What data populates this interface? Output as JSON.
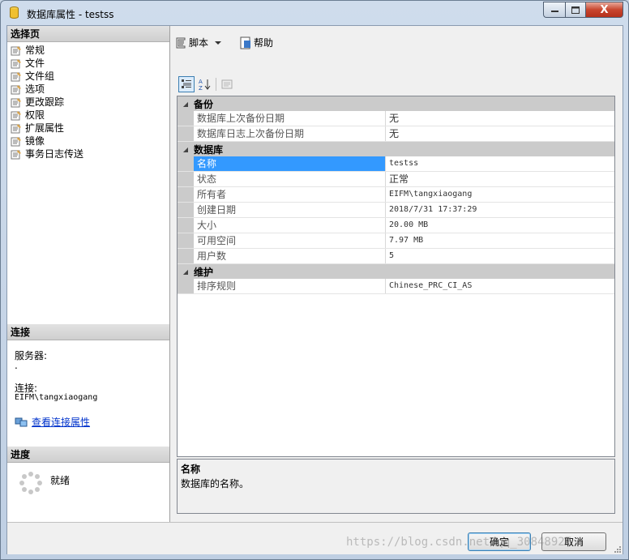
{
  "window": {
    "title": "数据库属性 - testss",
    "min_label": "–",
    "max_label": "□",
    "close_label": "X"
  },
  "left_pane": {
    "select_page_header": "选择页",
    "pages": [
      {
        "label": "常规"
      },
      {
        "label": "文件"
      },
      {
        "label": "文件组"
      },
      {
        "label": "选项"
      },
      {
        "label": "更改跟踪"
      },
      {
        "label": "权限"
      },
      {
        "label": "扩展属性"
      },
      {
        "label": "镜像"
      },
      {
        "label": "事务日志传送"
      }
    ],
    "connection_header": "连接",
    "server_label": "服务器:",
    "server_value": ".",
    "connection_label": "连接:",
    "connection_value": "EIFM\\tangxiaogang",
    "view_connection_link": "查看连接属性",
    "progress_header": "进度",
    "progress_status": "就绪"
  },
  "toolbar": {
    "script_label": "脚本",
    "help_label": "帮助"
  },
  "property_grid": {
    "categories": [
      {
        "name": "备份",
        "props": [
          {
            "name": "数据库上次备份日期",
            "value": "无"
          },
          {
            "name": "数据库日志上次备份日期",
            "value": "无"
          }
        ]
      },
      {
        "name": "数据库",
        "props": [
          {
            "name": "名称",
            "value": "testss"
          },
          {
            "name": "状态",
            "value": "正常"
          },
          {
            "name": "所有者",
            "value": "EIFM\\tangxiaogang"
          },
          {
            "name": "创建日期",
            "value": "2018/7/31 17:37:29"
          },
          {
            "name": "大小",
            "value": "20.00 MB"
          },
          {
            "name": "可用空间",
            "value": "7.97 MB"
          },
          {
            "name": "用户数",
            "value": "5"
          }
        ]
      },
      {
        "name": "维护",
        "props": [
          {
            "name": "排序规则",
            "value": "Chinese_PRC_CI_AS"
          }
        ]
      }
    ],
    "selected": "名称"
  },
  "description": {
    "title": "名称",
    "text": "数据库的名称。"
  },
  "buttons": {
    "ok_label": "确定",
    "cancel_label": "取消"
  },
  "watermark": "https://blog.csdn.net/qq_30848927",
  "colors": {
    "selection": "#3399ff",
    "category_bg": "#cbcbcb",
    "close_button": "#c8452e",
    "link": "#0033cc"
  }
}
